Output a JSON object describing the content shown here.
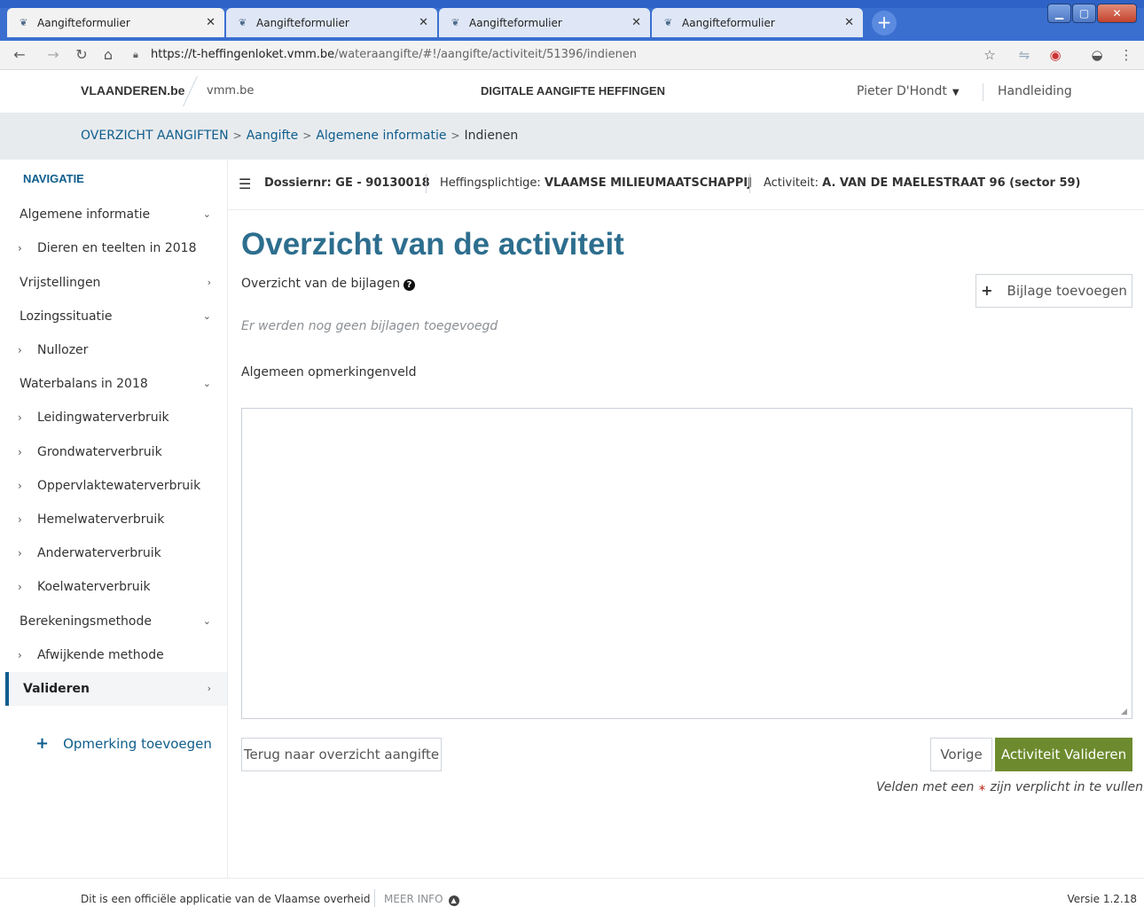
{
  "browser": {
    "tabs": [
      {
        "label": "Aangifteformulier",
        "active": true
      },
      {
        "label": "Aangifteformulier",
        "active": false
      },
      {
        "label": "Aangifteformulier",
        "active": false
      },
      {
        "label": "Aangifteformulier",
        "active": false
      }
    ],
    "url_host": "https://t-heffingenloket.vmm.be",
    "url_path": "/wateraangifte/#!/aangifte/activiteit/51396/indienen"
  },
  "header": {
    "brand": "VLAANDEREN.be",
    "brand_sub": "vmm.be",
    "app_title": "DIGITALE AANGIFTE HEFFINGEN",
    "user": "Pieter D'Hondt",
    "manual": "Handleiding"
  },
  "breadcrumb": {
    "items": [
      "OVERZICHT AANGIFTEN",
      "Aangifte",
      "Algemene informatie"
    ],
    "current": "Indienen"
  },
  "sidebar": {
    "title": "NAVIGATIE",
    "items": [
      {
        "label": "Algemene informatie",
        "chevron": "⌄"
      },
      {
        "label": "Dieren en teelten in 2018",
        "sub": true
      },
      {
        "label": "Vrijstellingen",
        "chevron": "›"
      },
      {
        "label": "Lozingssituatie",
        "chevron": "⌄"
      },
      {
        "label": "Nullozer",
        "sub": true
      },
      {
        "label": "Waterbalans in 2018",
        "chevron": "⌄"
      },
      {
        "label": "Leidingwaterverbruik",
        "sub": true
      },
      {
        "label": "Grondwaterverbruik",
        "sub": true
      },
      {
        "label": "Oppervlaktewaterverbruik",
        "sub": true
      },
      {
        "label": "Hemelwaterverbruik",
        "sub": true
      },
      {
        "label": "Anderwaterverbruik",
        "sub": true
      },
      {
        "label": "Koelwaterverbruik",
        "sub": true
      },
      {
        "label": "Berekeningsmethode",
        "chevron": "⌄"
      },
      {
        "label": "Afwijkende methode",
        "sub": true
      },
      {
        "label": "Valideren",
        "chevron": "›",
        "active": true
      }
    ],
    "add_note": "Opmerking toevoegen"
  },
  "infobar": {
    "dossier_label": "Dossiernr: GE - 90130018",
    "payer_label": "Heffingsplichtige:",
    "payer_value": "VLAAMSE MILIEUMAATSCHAPPIJ",
    "activity_label": "Activiteit:",
    "activity_value": "A. VAN DE MAELESTRAAT 96 (sector 59)"
  },
  "main": {
    "title": "Overzicht van de activiteit",
    "attachments_heading": "Overzicht van de bijlagen",
    "add_attachment": "Bijlage toevoegen",
    "no_attachments": "Er werden nog geen bijlagen toegevoegd",
    "remarks_label": "Algemeen opmerkingenveld",
    "remarks_value": "",
    "back_button": "Terug naar overzicht aangifte",
    "prev_button": "Vorige",
    "validate_button": "Activiteit Valideren",
    "required_prefix": "Velden met een",
    "required_star": "∗",
    "required_suffix": "zijn verplicht in te vullen."
  },
  "footer": {
    "official": "Dit is een officiële applicatie van de Vlaamse overheid",
    "more_info": "MEER INFO",
    "version": "Versie 1.2.18"
  },
  "colors": {
    "accent": "#0f5d8c",
    "title": "#2d6e8e",
    "validate": "#6d8b2e"
  }
}
